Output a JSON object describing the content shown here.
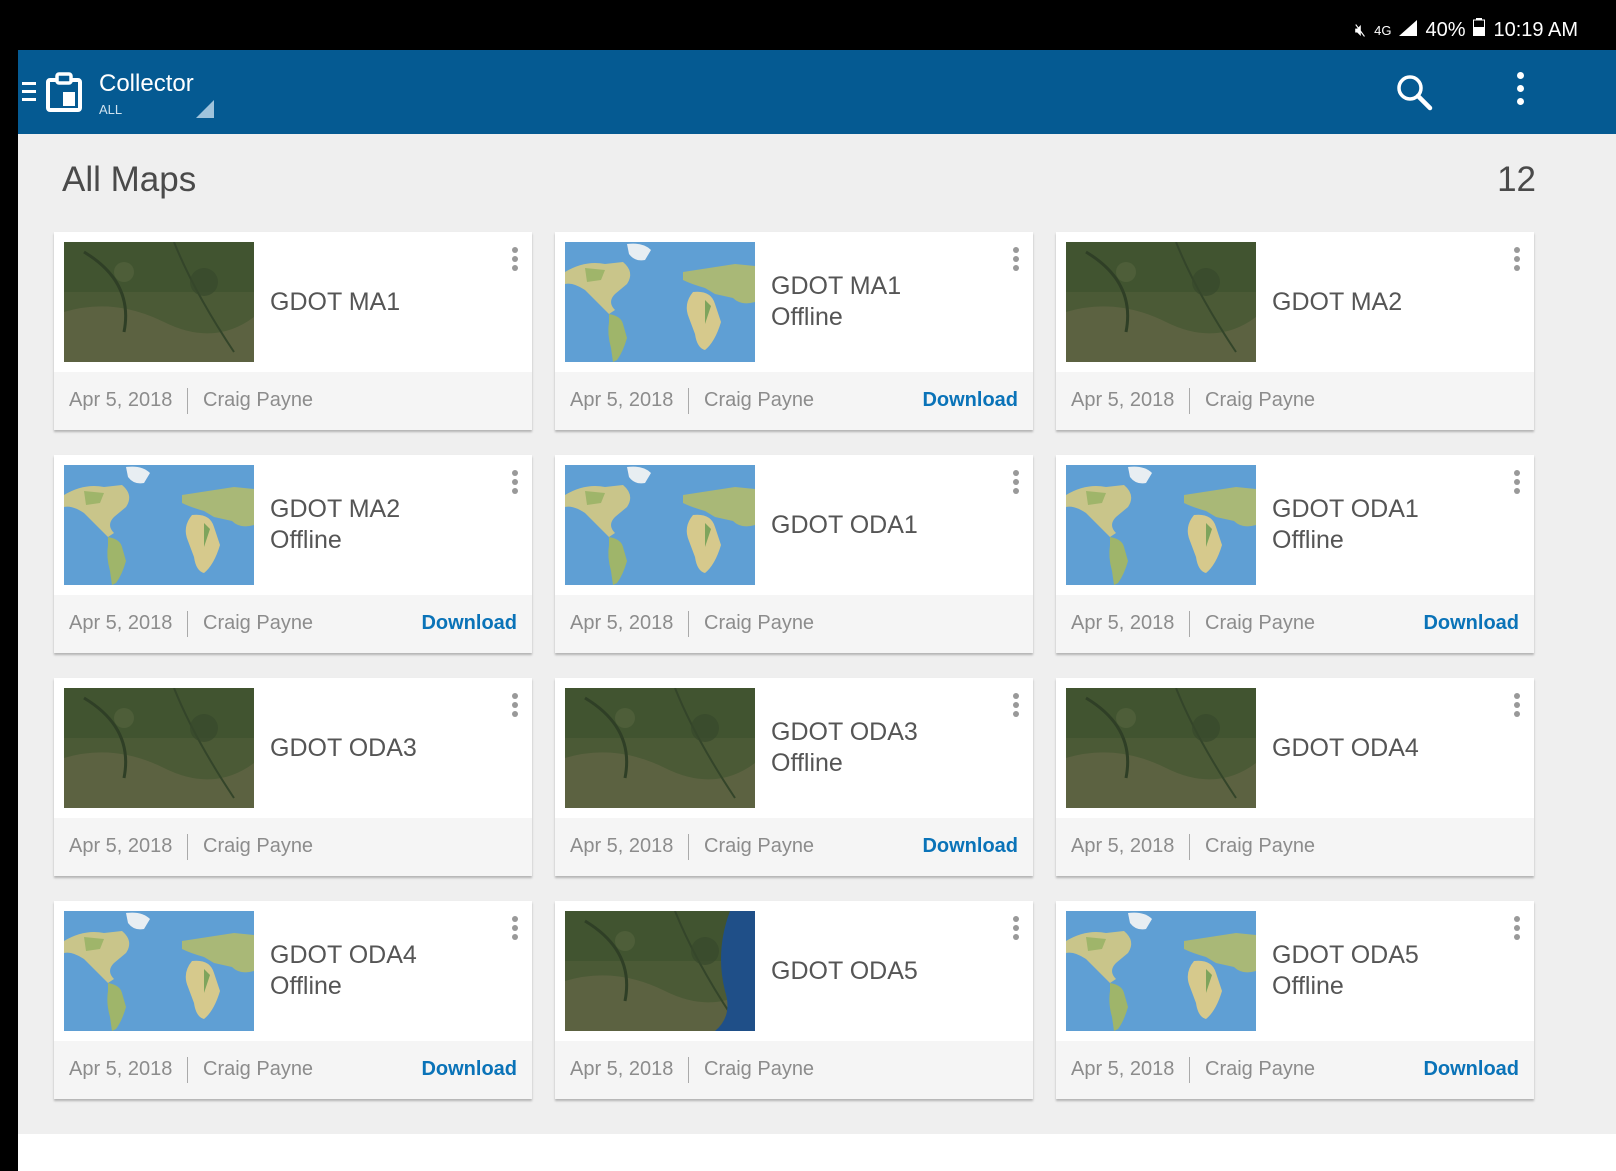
{
  "status_bar": {
    "signal": "4G",
    "battery": "40%",
    "time": "10:19 AM"
  },
  "app_bar": {
    "title": "Collector",
    "subtitle": "ALL"
  },
  "page": {
    "title": "All Maps",
    "count": "12"
  },
  "colors": {
    "app_bar": "#055a92",
    "download_link": "#0a73b8"
  },
  "maps": [
    {
      "name": "GDOT MA1",
      "subtitle": "",
      "date": "Apr 5, 2018",
      "author": "Craig Payne",
      "action": "",
      "thumbnail": "imagery"
    },
    {
      "name": "GDOT MA1",
      "subtitle": "Offline",
      "date": "Apr 5, 2018",
      "author": "Craig Payne",
      "action": "Download",
      "thumbnail": "world-map"
    },
    {
      "name": "GDOT MA2",
      "subtitle": "",
      "date": "Apr 5, 2018",
      "author": "Craig Payne",
      "action": "",
      "thumbnail": "imagery"
    },
    {
      "name": "GDOT MA2",
      "subtitle": "Offline",
      "date": "Apr 5, 2018",
      "author": "Craig Payne",
      "action": "Download",
      "thumbnail": "world-map"
    },
    {
      "name": "GDOT ODA1",
      "subtitle": "",
      "date": "Apr 5, 2018",
      "author": "Craig Payne",
      "action": "",
      "thumbnail": "world-map"
    },
    {
      "name": "GDOT ODA1",
      "subtitle": "Offline",
      "date": "Apr 5, 2018",
      "author": "Craig Payne",
      "action": "Download",
      "thumbnail": "world-map"
    },
    {
      "name": "GDOT ODA3",
      "subtitle": "",
      "date": "Apr 5, 2018",
      "author": "Craig Payne",
      "action": "",
      "thumbnail": "imagery"
    },
    {
      "name": "GDOT ODA3",
      "subtitle": "Offline",
      "date": "Apr 5, 2018",
      "author": "Craig Payne",
      "action": "Download",
      "thumbnail": "imagery"
    },
    {
      "name": "GDOT ODA4",
      "subtitle": "",
      "date": "Apr 5, 2018",
      "author": "Craig Payne",
      "action": "",
      "thumbnail": "imagery"
    },
    {
      "name": "GDOT ODA4",
      "subtitle": "Offline",
      "date": "Apr 5, 2018",
      "author": "Craig Payne",
      "action": "Download",
      "thumbnail": "world-map"
    },
    {
      "name": "GDOT ODA5",
      "subtitle": "",
      "date": "Apr 5, 2018",
      "author": "Craig Payne",
      "action": "",
      "thumbnail": "imagery-coast"
    },
    {
      "name": "GDOT ODA5",
      "subtitle": "Offline",
      "date": "Apr 5, 2018",
      "author": "Craig Payne",
      "action": "Download",
      "thumbnail": "world-map"
    }
  ]
}
